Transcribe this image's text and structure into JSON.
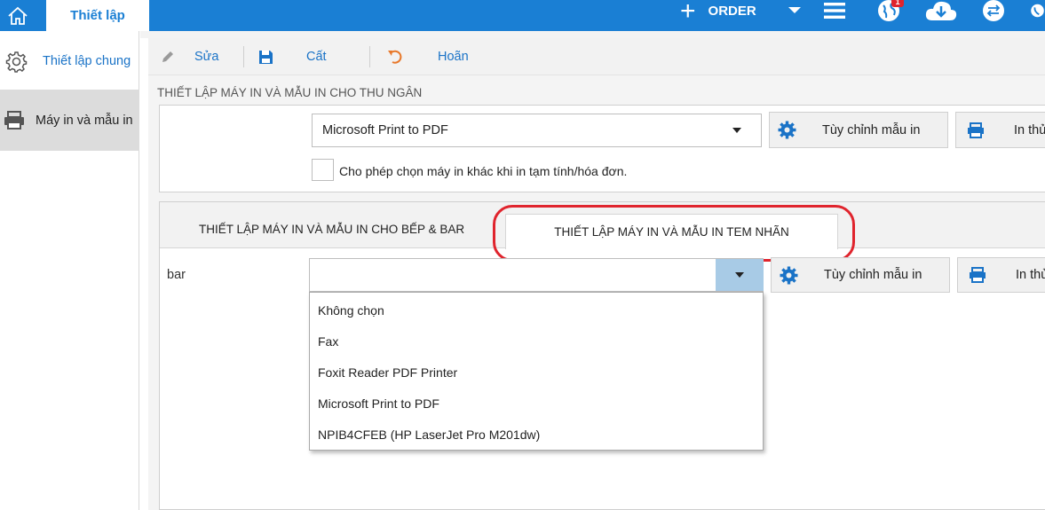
{
  "topbar": {
    "active_tab": "Thiết lập",
    "order_label": "ORDER",
    "notification_count": "1",
    "accent": "#1a7fd4"
  },
  "sidebar": {
    "items": [
      {
        "label": "Thiết lập chung",
        "icon": "gear-icon"
      },
      {
        "label": "Máy in và mẫu in",
        "icon": "printer-icon"
      }
    ]
  },
  "toolbar": {
    "edit_label": "Sửa",
    "save_label": "Cất",
    "undo_label": "Hoãn"
  },
  "cashier": {
    "title": "THIẾT LẬP MÁY IN VÀ MẪU IN CHO THU NGÂN",
    "printer_value": "Microsoft Print to PDF",
    "customize_label": "Tùy chỉnh mẫu in",
    "test_print_label": "In thử",
    "allow_other_label": "Cho phép chọn máy in khác khi in tạm tính/hóa đơn."
  },
  "tabs": [
    {
      "label": "THIẾT LẬP MÁY IN VÀ MẪU IN CHO BẾP & BAR"
    },
    {
      "label": "THIẾT LẬP MÁY IN VÀ MẪU IN TEM NHÃN"
    }
  ],
  "label_section": {
    "row_label": "bar",
    "printer_value": "",
    "customize_label": "Tùy chỉnh mẫu in",
    "test_print_label": "In thử",
    "dropdown_options": [
      "Không chọn",
      "Fax",
      "Foxit Reader PDF Printer",
      "Microsoft Print to PDF",
      "NPIB4CFEB (HP LaserJet Pro M201dw)"
    ]
  },
  "colors": {
    "highlight": "#e0242d",
    "link": "#1a73c7",
    "dropdown_arrow_bg": "#a8cbe6"
  }
}
